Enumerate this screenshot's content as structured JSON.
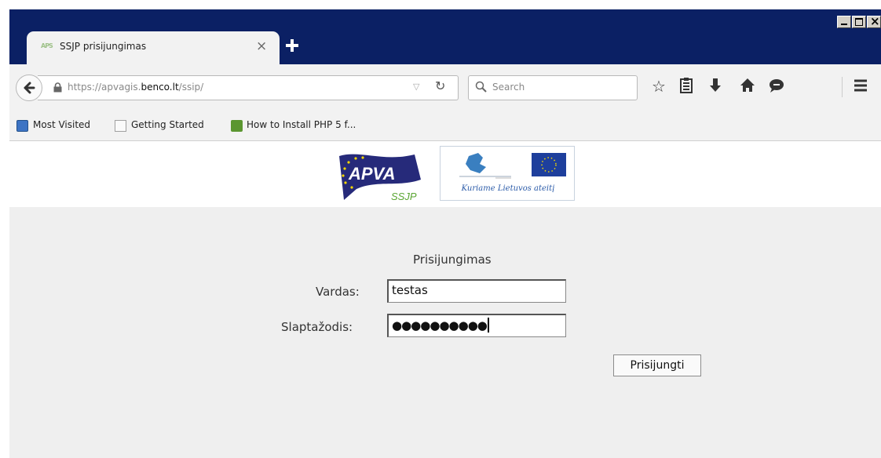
{
  "window": {
    "controls": [
      "minimize",
      "maximize",
      "close"
    ]
  },
  "tab": {
    "title": "SSJP prisijungimas",
    "favicon_text": "APS",
    "close_glyph": "×"
  },
  "navbar": {
    "url_prefix": "https://apvagis.",
    "url_domain": "benco.lt",
    "url_path": "/ssip/",
    "search_placeholder": "Search"
  },
  "bookmarks": [
    {
      "label": "Most Visited"
    },
    {
      "label": "Getting Started"
    },
    {
      "label": "How to Install PHP 5 f..."
    }
  ],
  "header": {
    "logo_text": "APVA",
    "logo_sub": "SSJP",
    "eu_slogan": "Kuriame Lietuvos ateitį"
  },
  "login": {
    "title": "Prisijungimas",
    "username_label": "Vardas:",
    "username_value": "testas",
    "password_label": "Slaptažodis:",
    "password_mask": "●●●●●●●●●●",
    "submit_label": "Prisijungti"
  },
  "colors": {
    "titlebar": "#0b2064",
    "logo_blue": "#262a7a",
    "logo_green": "#5aa532",
    "eu_flag": "#1e3f9c",
    "eu_stars": "#f5d800"
  }
}
